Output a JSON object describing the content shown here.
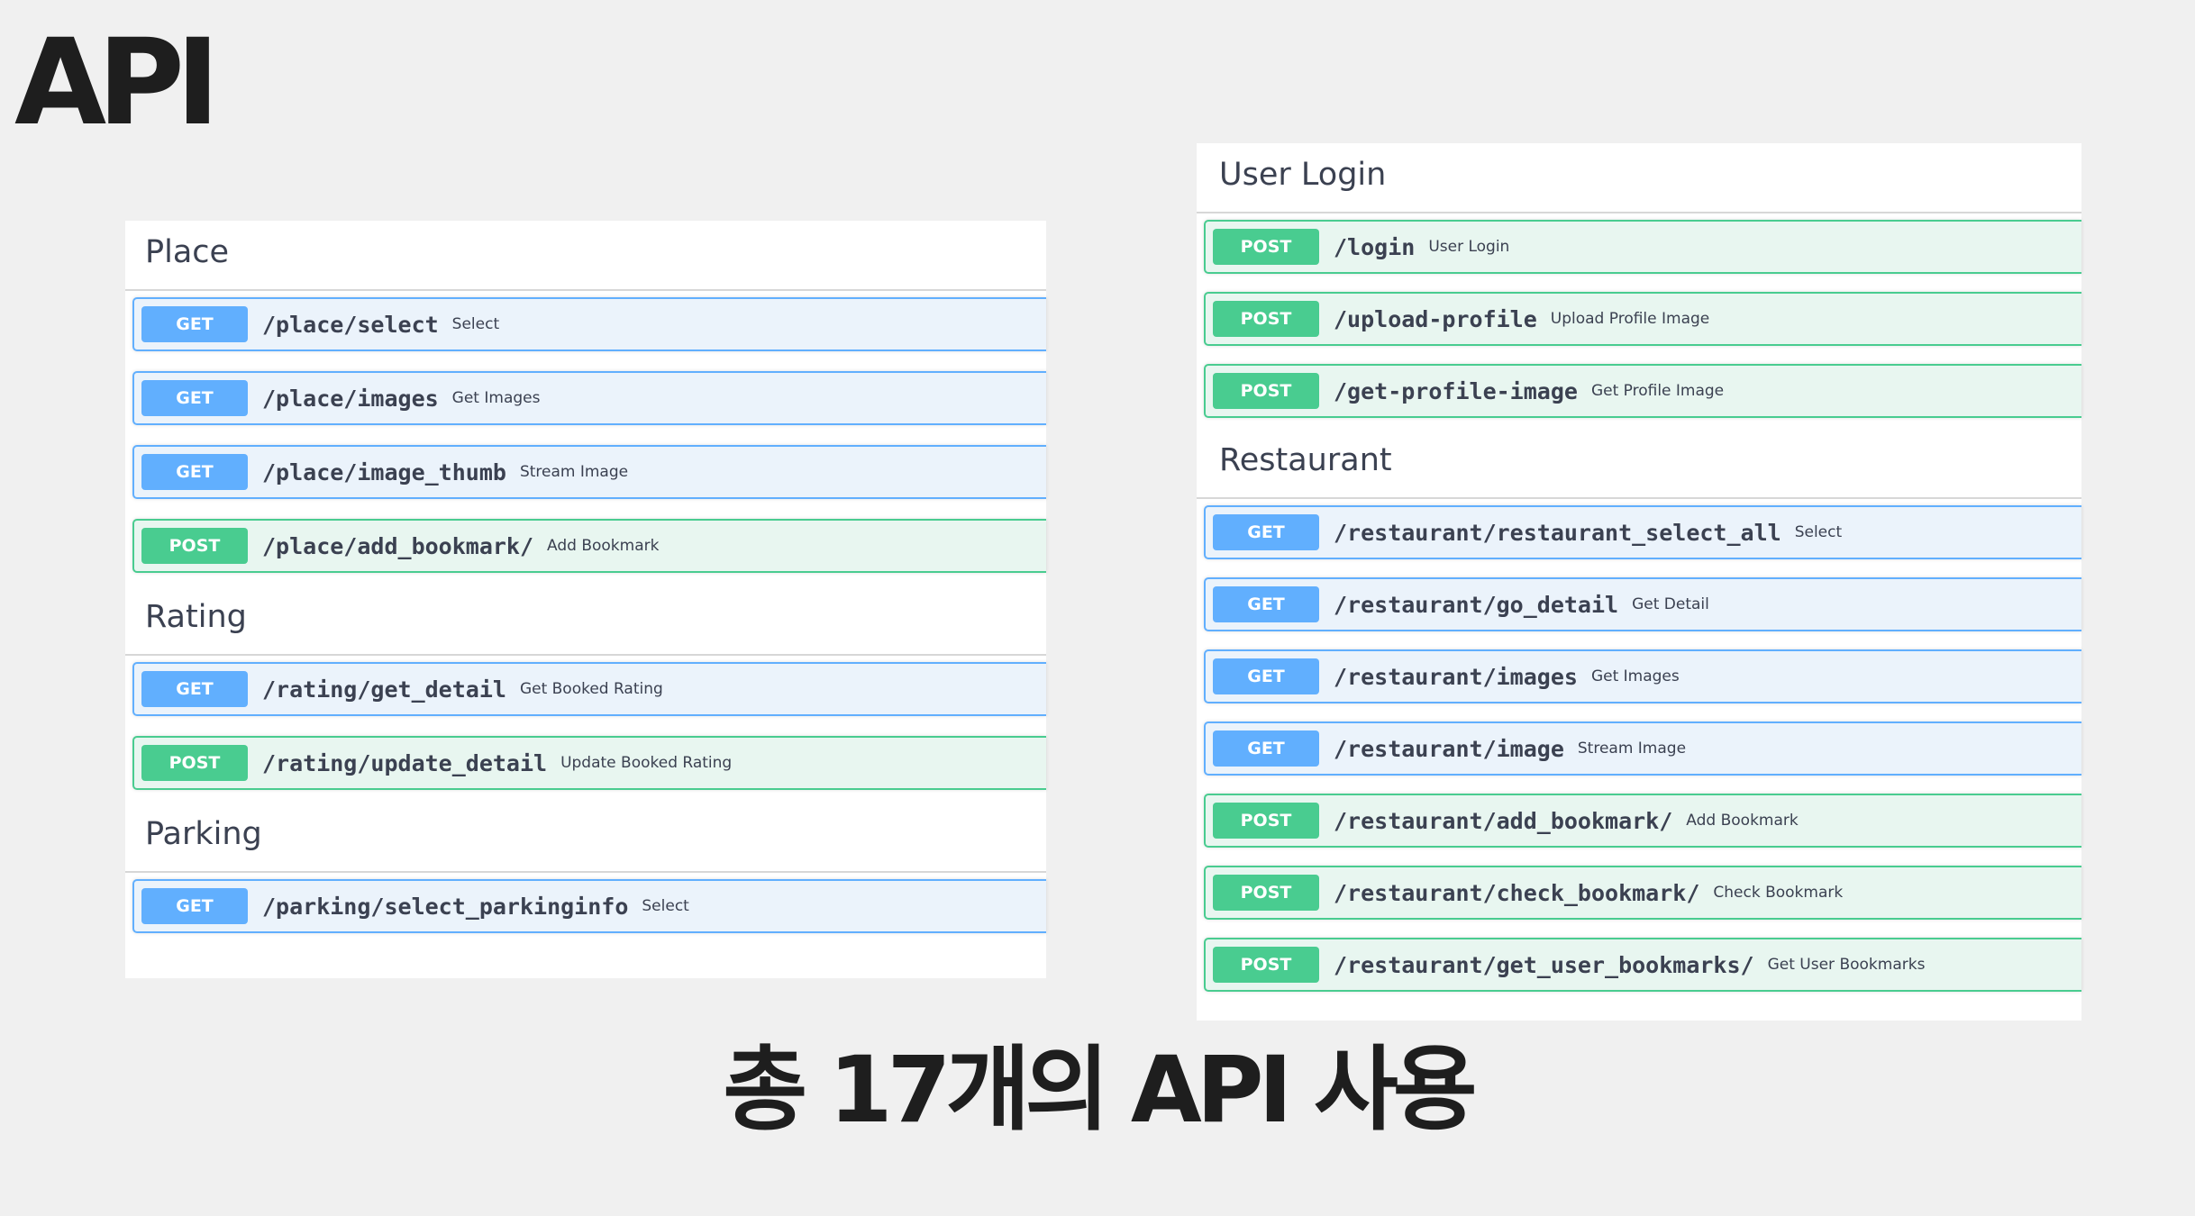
{
  "slide": {
    "title": "API",
    "footer": "총 17개의 API 사용"
  },
  "left_panel": {
    "groups": [
      {
        "title": "Place",
        "ops": [
          {
            "method": "GET",
            "path": "/place/select",
            "summary": "Select"
          },
          {
            "method": "GET",
            "path": "/place/images",
            "summary": "Get Images"
          },
          {
            "method": "GET",
            "path": "/place/image_thumb",
            "summary": "Stream Image"
          },
          {
            "method": "POST",
            "path": "/place/add_bookmark/",
            "summary": "Add Bookmark"
          }
        ]
      },
      {
        "title": "Rating",
        "ops": [
          {
            "method": "GET",
            "path": "/rating/get_detail",
            "summary": "Get Booked Rating"
          },
          {
            "method": "POST",
            "path": "/rating/update_detail",
            "summary": "Update Booked Rating"
          }
        ]
      },
      {
        "title": "Parking",
        "ops": [
          {
            "method": "GET",
            "path": "/parking/select_parkinginfo",
            "summary": "Select"
          }
        ]
      }
    ]
  },
  "right_panel": {
    "groups": [
      {
        "title": "User Login",
        "ops": [
          {
            "method": "POST",
            "path": "/login",
            "summary": "User Login"
          },
          {
            "method": "POST",
            "path": "/upload-profile",
            "summary": "Upload Profile Image"
          },
          {
            "method": "POST",
            "path": "/get-profile-image",
            "summary": "Get Profile Image"
          }
        ]
      },
      {
        "title": "Restaurant",
        "ops": [
          {
            "method": "GET",
            "path": "/restaurant/restaurant_select_all",
            "summary": "Select"
          },
          {
            "method": "GET",
            "path": "/restaurant/go_detail",
            "summary": "Get Detail"
          },
          {
            "method": "GET",
            "path": "/restaurant/images",
            "summary": "Get Images"
          },
          {
            "method": "GET",
            "path": "/restaurant/image",
            "summary": "Stream Image"
          },
          {
            "method": "POST",
            "path": "/restaurant/add_bookmark/",
            "summary": "Add Bookmark"
          },
          {
            "method": "POST",
            "path": "/restaurant/check_bookmark/",
            "summary": "Check Bookmark"
          },
          {
            "method": "POST",
            "path": "/restaurant/get_user_bookmarks/",
            "summary": "Get User Bookmarks"
          }
        ]
      }
    ]
  },
  "colors": {
    "get": "#61affe",
    "post": "#49cc90",
    "get_bg": "#ebf3fb",
    "post_bg": "#e8f6f0"
  }
}
